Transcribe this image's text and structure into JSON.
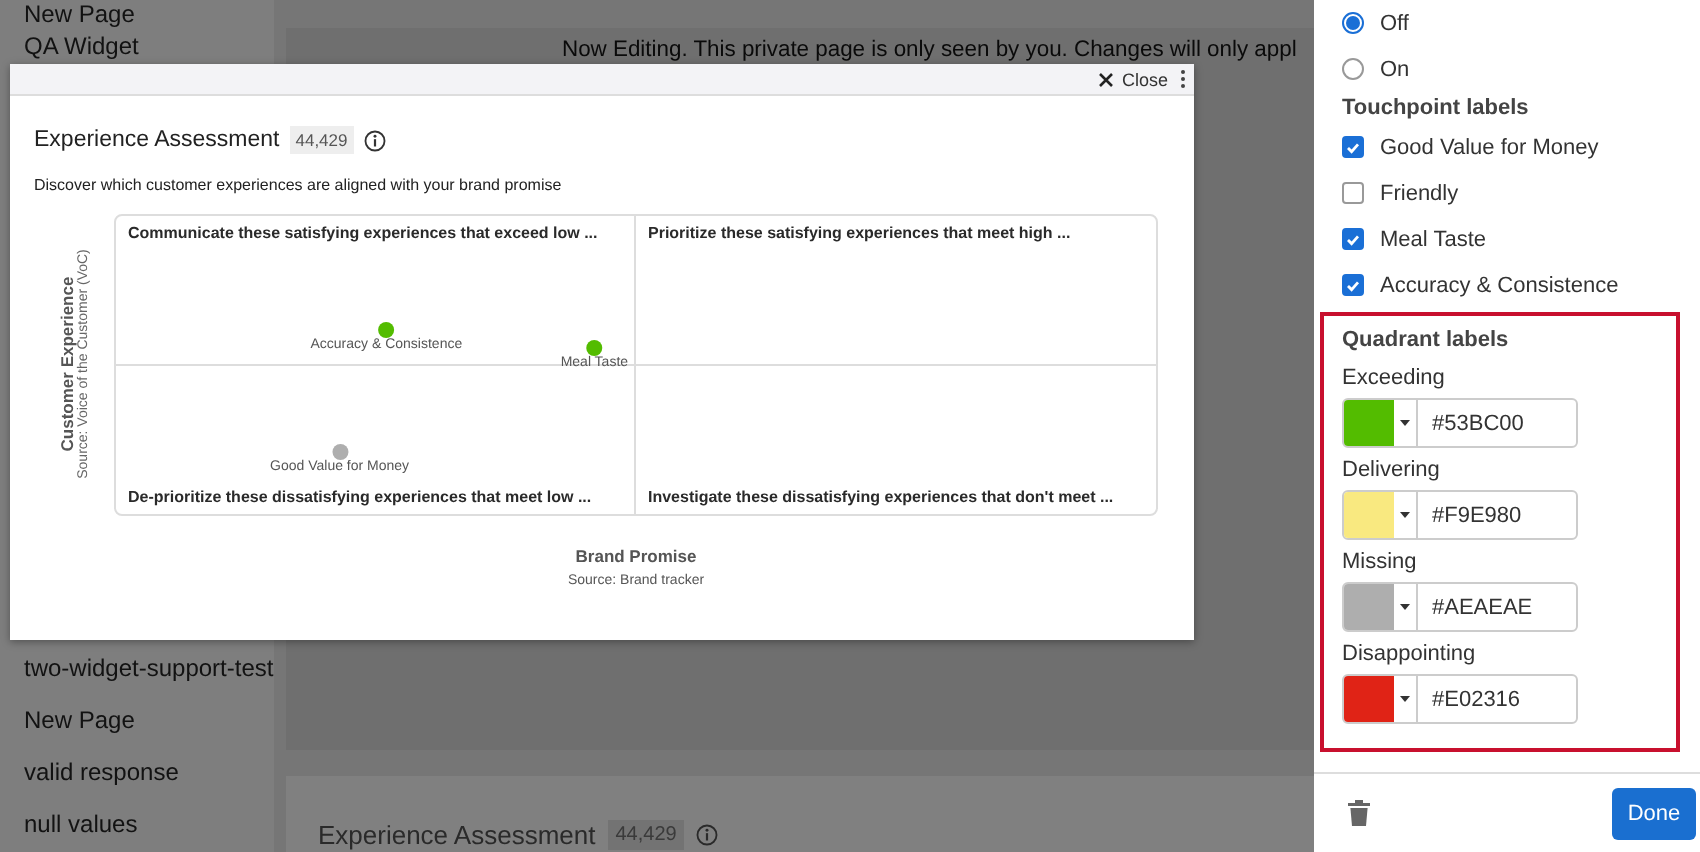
{
  "sidebar": {
    "items": [
      "New Page",
      "QA Widget",
      "two-widget-support-test",
      "New Page",
      "valid response",
      "null values"
    ]
  },
  "banner": {
    "text": "Now Editing. This private page is only seen by you. Changes will only appl"
  },
  "background_card": {
    "title": "Experience Assessment",
    "count": "44,429"
  },
  "modal": {
    "close": "Close",
    "title": "Experience Assessment",
    "count": "44,429",
    "description": "Discover which customer experiences are aligned with your brand promise",
    "chart": {
      "y_title": "Customer Experience",
      "y_subtitle": "Source: Voice of the Customer (VoC)",
      "x_title": "Brand Promise",
      "x_subtitle": "Source: Brand tracker",
      "quadrants": [
        "Communicate these satisfying experiences that exceed low ...",
        "Prioritize these satisfying experiences that meet high ...",
        "De-prioritize these dissatisfying experiences that meet low ...",
        "Investigate these dissatisfying experiences that don't meet ..."
      ],
      "points": [
        {
          "label": "Accuracy & Consistence",
          "color": "#53bc00"
        },
        {
          "label": "Meal Taste",
          "color": "#53bc00"
        },
        {
          "label": "Good Value for Money",
          "color": "#aeaeae"
        }
      ]
    }
  },
  "panel": {
    "radios": [
      {
        "label": "Off",
        "selected": true
      },
      {
        "label": "On",
        "selected": false
      }
    ],
    "touchpoint_heading": "Touchpoint labels",
    "touchpoints": [
      {
        "label": "Good Value for Money",
        "checked": true
      },
      {
        "label": "Friendly",
        "checked": false
      },
      {
        "label": "Meal Taste",
        "checked": true
      },
      {
        "label": "Accuracy & Consistence",
        "checked": true
      }
    ],
    "quadrant_heading": "Quadrant labels",
    "quadrant_colors": [
      {
        "label": "Exceeding",
        "color": "#53bc00",
        "value": "#53BC00"
      },
      {
        "label": "Delivering",
        "color": "#f9e980",
        "value": "#F9E980"
      },
      {
        "label": "Missing",
        "color": "#aeaeae",
        "value": "#AEAEAE"
      },
      {
        "label": "Disappointing",
        "color": "#e02316",
        "value": "#E02316"
      }
    ],
    "done": "Done"
  }
}
